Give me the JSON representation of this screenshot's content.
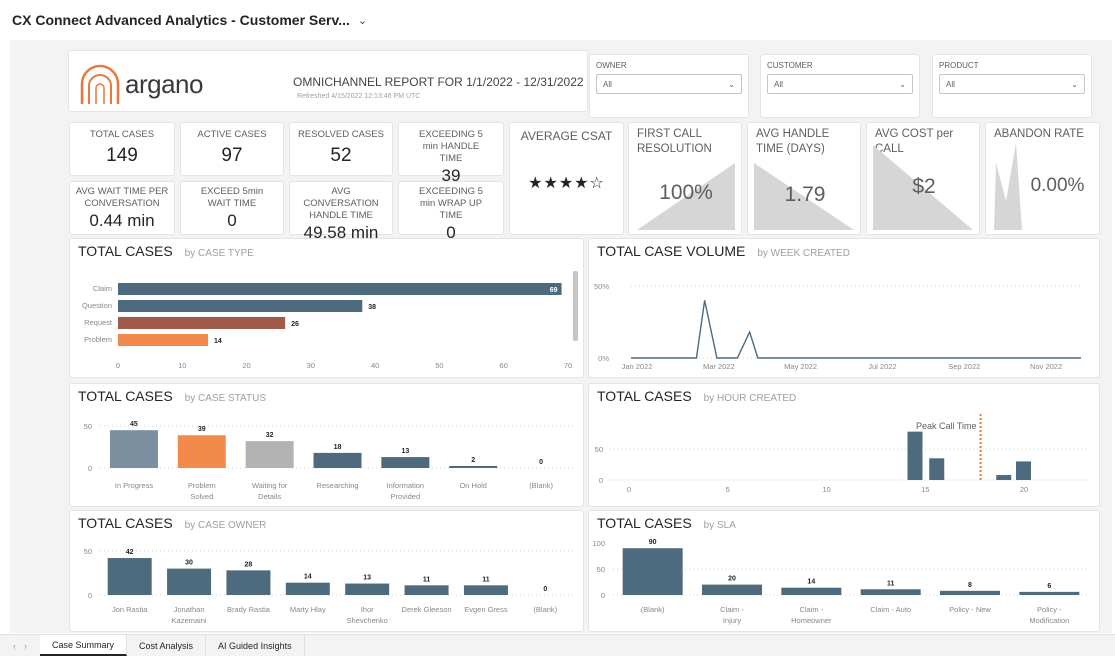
{
  "window": {
    "title": "CX Connect Advanced Analytics - Customer Serv...",
    "dropdown_icon": "chevron-down-icon"
  },
  "header": {
    "logo_text": "argano",
    "report_title": "OMNICHANNEL REPORT FOR 1/1/2022 - 12/31/2022",
    "refreshed": "Refreshed 4/15/2022 12:13:46 PM UTC"
  },
  "filters": [
    {
      "label": "OWNER",
      "value": "All"
    },
    {
      "label": "CUSTOMER",
      "value": "All"
    },
    {
      "label": "PRODUCT",
      "value": "All"
    }
  ],
  "kpis": [
    {
      "label": "TOTAL CASES",
      "value": "149"
    },
    {
      "label": "ACTIVE CASES",
      "value": "97"
    },
    {
      "label": "RESOLVED CASES",
      "value": "52"
    },
    {
      "label": "EXCEEDING 5 min HANDLE TIME",
      "value": "39"
    },
    {
      "label": "AVG WAIT TIME PER CONVERSATION",
      "value": "0.44 min"
    },
    {
      "label": "EXCEED 5min WAIT TIME",
      "value": "0"
    },
    {
      "label": "AVG CONVERSATION HANDLE TIME",
      "value": "49.58 min"
    },
    {
      "label": "EXCEEDING 5 min WRAP UP TIME",
      "value": "0"
    }
  ],
  "csat": {
    "label": "AVERAGE CSAT",
    "stars": "★★★★☆",
    "rating": 4,
    "max": 5
  },
  "big_kpis": [
    {
      "label": "FIRST CALL RESOLUTION",
      "value": "100%"
    },
    {
      "label": "AVG HANDLE TIME (DAYS)",
      "value": "1.79"
    },
    {
      "label": "AVG COST per CALL",
      "value": "$2"
    },
    {
      "label": "ABANDON RATE",
      "value": "0.00%"
    }
  ],
  "panels": {
    "case_type": {
      "title": "TOTAL CASES",
      "subtitle": "by CASE TYPE"
    },
    "volume": {
      "title": "TOTAL CASE VOLUME",
      "subtitle": "by WEEK CREATED"
    },
    "status": {
      "title": "TOTAL CASES",
      "subtitle": "by CASE STATUS"
    },
    "hour": {
      "title": "TOTAL CASES",
      "subtitle": "by HOUR CREATED",
      "annotation": "Peak Call Time"
    },
    "owner": {
      "title": "TOTAL CASES",
      "subtitle": "by CASE OWNER"
    },
    "sla": {
      "title": "TOTAL CASES",
      "subtitle": "by SLA"
    }
  },
  "chart_data": [
    {
      "type": "bar",
      "orientation": "horizontal",
      "title": "TOTAL CASES",
      "subtitle": "by CASE TYPE",
      "categories": [
        "Claim",
        "Question",
        "Request",
        "Problem"
      ],
      "values": [
        69,
        38,
        26,
        14
      ],
      "colors": [
        "#4e6a7e",
        "#4e6a7e",
        "#a05a48",
        "#f28a4c"
      ],
      "xlim": [
        0,
        70
      ],
      "xticks": [
        "0",
        "10",
        "20",
        "30",
        "40",
        "50",
        "60",
        "70"
      ]
    },
    {
      "type": "line",
      "title": "TOTAL CASE VOLUME",
      "subtitle": "by WEEK CREATED",
      "x": [
        "Jan 2022",
        "Feb 2022",
        "Mar 2022",
        "Apr 2022",
        "May 2022",
        "Jun 2022",
        "Jul 2022",
        "Aug 2022",
        "Sep 2022",
        "Oct 2022",
        "Nov 2022",
        "Dec 2022"
      ],
      "y_percent": [
        0,
        0,
        40,
        0,
        18,
        0,
        0,
        0,
        0,
        0,
        0,
        0
      ],
      "ylim": [
        0,
        50
      ],
      "yticks": [
        "0%",
        "50%"
      ],
      "xticks": [
        "Jan 2022",
        "Mar 2022",
        "May 2022",
        "Jul 2022",
        "Sep 2022",
        "Nov 2022"
      ]
    },
    {
      "type": "bar",
      "title": "TOTAL CASES",
      "subtitle": "by CASE STATUS",
      "categories": [
        "In Progress",
        "Problem Solved",
        "Waiting for Details",
        "Researching",
        "Information Provided",
        "On Hold",
        "(Blank)"
      ],
      "values": [
        45,
        39,
        32,
        18,
        13,
        2,
        0
      ],
      "colors": [
        "#7b8fa0",
        "#f28a4c",
        "#b3b3b3",
        "#4e6a7e",
        "#4e6a7e",
        "#4e6a7e",
        "#4e6a7e"
      ],
      "ylim": [
        0,
        50
      ],
      "yticks": [
        "0",
        "50"
      ]
    },
    {
      "type": "bar",
      "title": "TOTAL CASES",
      "subtitle": "by HOUR CREATED",
      "x": [
        15,
        16,
        19,
        20
      ],
      "values": [
        78,
        0,
        8,
        30
      ],
      "bar_hours": [
        14,
        15,
        19,
        20
      ],
      "bar_values": [
        78,
        35,
        8,
        30
      ],
      "xlim": [
        0,
        23
      ],
      "ylim": [
        0,
        100
      ],
      "yticks": [
        "0",
        "50"
      ],
      "xticks": [
        "0",
        "5",
        "10",
        "15",
        "20"
      ],
      "annotation": {
        "text": "Peak Call Time",
        "x": 17.8
      }
    },
    {
      "type": "bar",
      "title": "TOTAL CASES",
      "subtitle": "by CASE OWNER",
      "categories": [
        "Jon Rastia",
        "Jonathan Kazemaini",
        "Brady Rastia",
        "Marty Hlay",
        "Ihor Shevchenko",
        "Derek Gleeson",
        "Evgen Gress",
        "(Blank)"
      ],
      "values": [
        42,
        30,
        28,
        14,
        13,
        11,
        11,
        0
      ],
      "ylim": [
        0,
        50
      ],
      "yticks": [
        "0",
        "50"
      ]
    },
    {
      "type": "bar",
      "title": "TOTAL CASES",
      "subtitle": "by SLA",
      "categories": [
        "(Blank)",
        "Claim - Injury",
        "Claim - Homeowner",
        "Claim - Auto",
        "Policy - New",
        "Policy - Modification"
      ],
      "values": [
        90,
        20,
        14,
        11,
        8,
        6
      ],
      "ylim": [
        0,
        100
      ],
      "yticks": [
        "0",
        "50",
        "100"
      ]
    }
  ],
  "tabs": [
    "Case Summary",
    "Cost Analysis",
    "AI Guided Insights"
  ],
  "active_tab": "Case Summary",
  "colors": {
    "accent": "#4e6a7e",
    "orange": "#f28a4c",
    "rust": "#a05a48",
    "gray": "#b3b3b3"
  }
}
